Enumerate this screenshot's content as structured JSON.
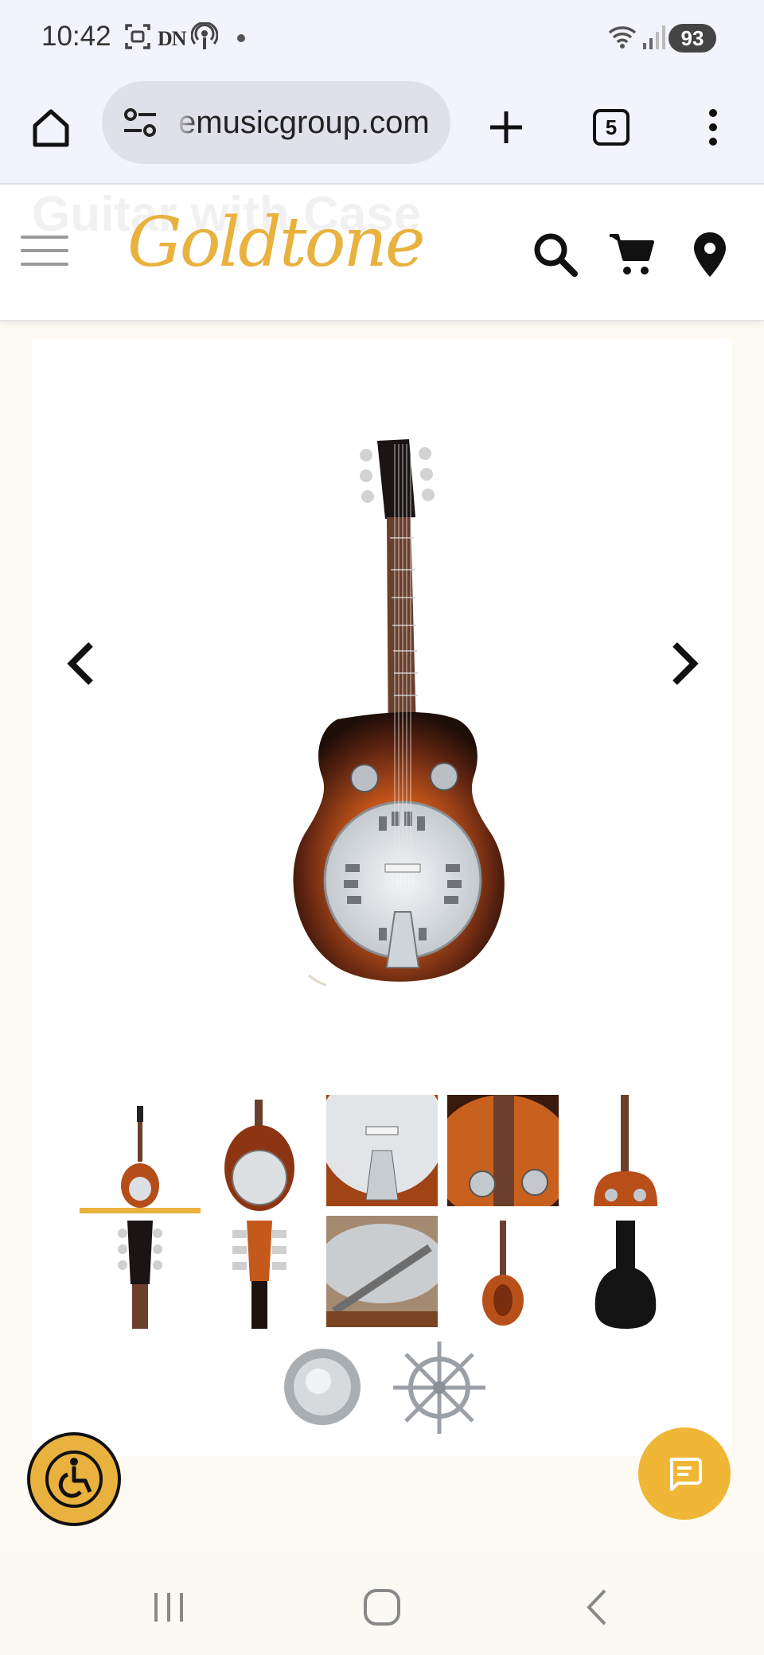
{
  "status_bar": {
    "time": "10:42",
    "dn_label": "DN",
    "battery": "93",
    "icons": [
      "screenshot-icon",
      "dn-icon",
      "podcast-icon",
      "dot-icon",
      "wifi-icon",
      "signal-icon"
    ]
  },
  "browser": {
    "url": "emusicgroup.com",
    "tab_count": "5",
    "icons": [
      "home-icon",
      "site-settings-icon",
      "new-tab-icon",
      "tab-switcher-icon",
      "menu-icon"
    ]
  },
  "site": {
    "ghost_title": "Guitar with Case",
    "logo_text": "Goldtone",
    "icons": [
      "hamburger-menu-icon",
      "search-icon",
      "cart-icon",
      "location-icon"
    ]
  },
  "gallery": {
    "selected_index": 0,
    "thumbnail_count": 12,
    "icons": [
      "chevron-left-icon",
      "chevron-right-icon"
    ]
  },
  "colors": {
    "brand_gold": "#e9b23f",
    "sunburst_dark": "#2a140c",
    "sunburst_mid": "#c2541a",
    "chrome": "#d9dde0"
  },
  "floating": {
    "icons": [
      "accessibility-icon",
      "chat-icon"
    ]
  },
  "navbar": {
    "icons": [
      "recent-apps-icon",
      "home-nav-icon",
      "back-nav-icon"
    ]
  }
}
